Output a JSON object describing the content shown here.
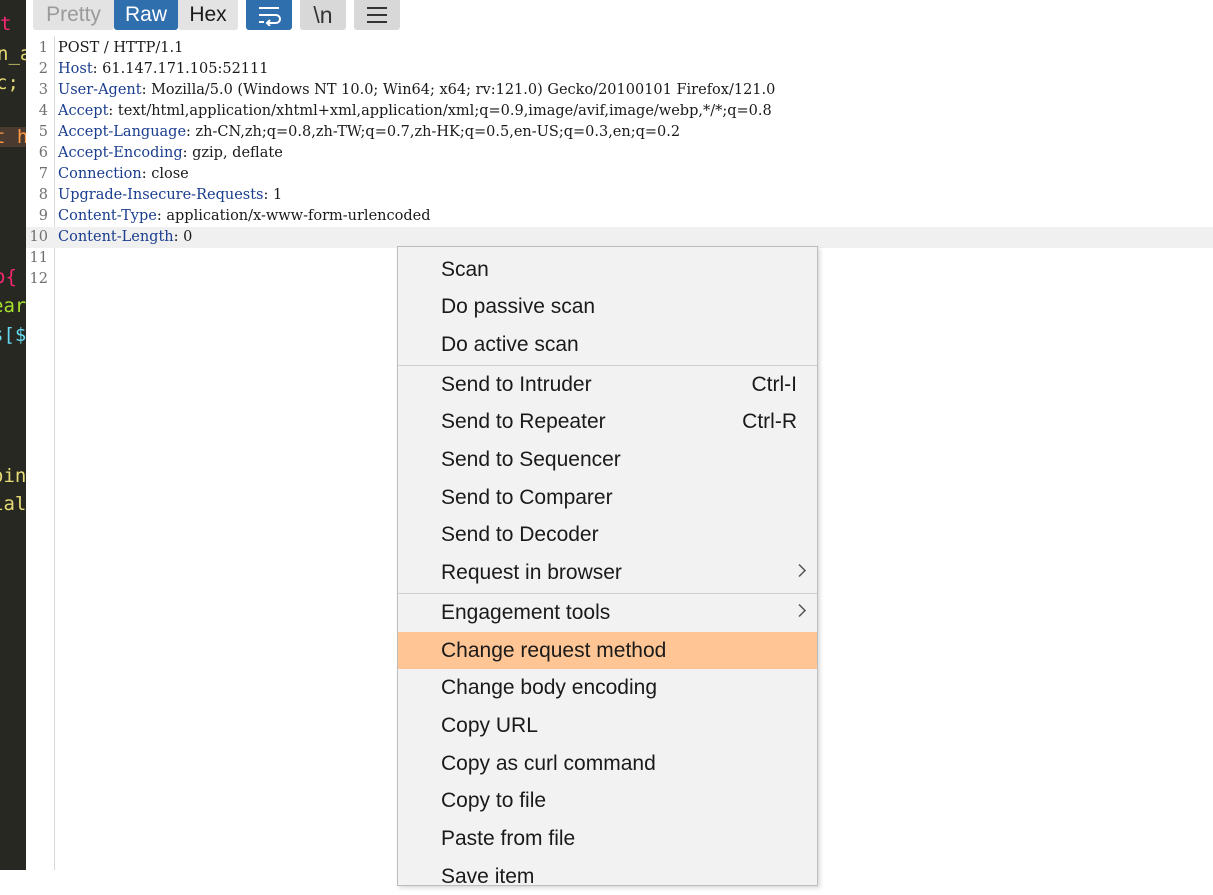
{
  "toolbar": {
    "pretty_label": "Pretty",
    "raw_label": "Raw",
    "hex_label": "Hex",
    "wrap_icon": "word-wrap-icon",
    "newline_label": "\\n",
    "menu_icon": "hamburger-menu-icon"
  },
  "left_fragments": [
    "t",
    "n_a",
    "c;",
    "t h",
    "o{",
    "ear",
    "s[$",
    "oin",
    "ial"
  ],
  "request_lines": [
    {
      "num": "1",
      "name": "",
      "value": "POST / HTTP/1.1"
    },
    {
      "num": "2",
      "name": "Host",
      "value": " 61.147.171.105:52111"
    },
    {
      "num": "3",
      "name": "User-Agent",
      "value": " Mozilla/5.0 (Windows NT 10.0; Win64; x64; rv:121.0) Gecko/20100101 Firefox/121.0"
    },
    {
      "num": "4",
      "name": "Accept",
      "value": " text/html,application/xhtml+xml,application/xml;q=0.9,image/avif,image/webp,*/*;q=0.8"
    },
    {
      "num": "5",
      "name": "Accept-Language",
      "value": " zh-CN,zh;q=0.8,zh-TW;q=0.7,zh-HK;q=0.5,en-US;q=0.3,en;q=0.2"
    },
    {
      "num": "6",
      "name": "Accept-Encoding",
      "value": " gzip, deflate"
    },
    {
      "num": "7",
      "name": "Connection",
      "value": " close"
    },
    {
      "num": "8",
      "name": "Upgrade-Insecure-Requests",
      "value": " 1"
    },
    {
      "num": "9",
      "name": "Content-Type",
      "value": " application/x-www-form-urlencoded"
    },
    {
      "num": "10",
      "name": "Content-Length",
      "value": " 0"
    },
    {
      "num": "11",
      "name": "",
      "value": ""
    },
    {
      "num": "12",
      "name": "",
      "value": ""
    }
  ],
  "context_menu": {
    "items": [
      {
        "label": "Scan"
      },
      {
        "label": "Do passive scan"
      },
      {
        "label": "Do active scan"
      },
      {
        "label": "Send to Intruder",
        "shortcut": "Ctrl-I"
      },
      {
        "label": "Send to Repeater",
        "shortcut": "Ctrl-R"
      },
      {
        "label": "Send to Sequencer"
      },
      {
        "label": "Send to Comparer"
      },
      {
        "label": "Send to Decoder"
      },
      {
        "label": "Request in browser",
        "submenu_icon": "chevron-right-icon"
      },
      {
        "label": "Engagement tools",
        "submenu_icon": "chevron-right-icon"
      },
      {
        "label": "Change request method",
        "highlighted": true
      },
      {
        "label": "Change body encoding"
      },
      {
        "label": "Copy URL"
      },
      {
        "label": "Copy as curl command"
      },
      {
        "label": "Copy to file"
      },
      {
        "label": "Paste from file"
      },
      {
        "label": "Save item"
      }
    ]
  },
  "colors": {
    "accent": "#2f6fae",
    "highlight": "#ffc594",
    "header_name": "#1a3d8f"
  }
}
